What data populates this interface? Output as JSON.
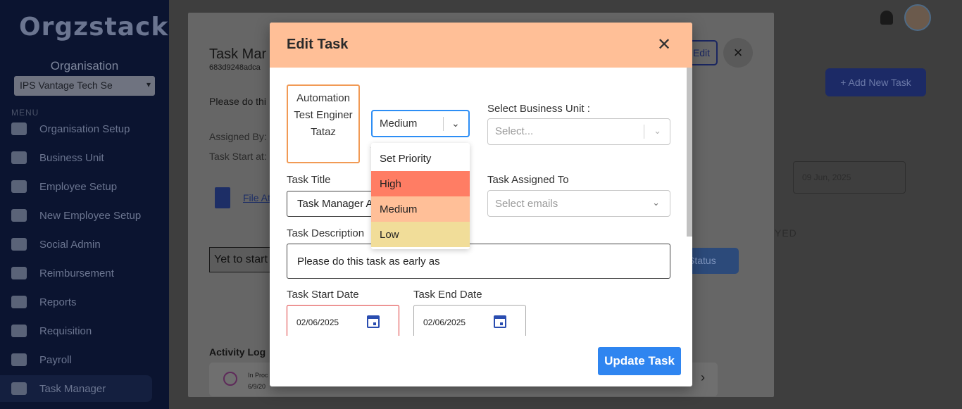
{
  "sidebar": {
    "logo": "Orgzstack",
    "org_label": "Organisation",
    "org_select": "IPS Vantage Tech Se",
    "menu_label": "MENU",
    "items": [
      {
        "label": "Organisation Setup"
      },
      {
        "label": "Business Unit"
      },
      {
        "label": "Employee Setup"
      },
      {
        "label": "New Employee Setup"
      },
      {
        "label": "Social Admin"
      },
      {
        "label": "Reimbursement"
      },
      {
        "label": "Reports"
      },
      {
        "label": "Requisition"
      },
      {
        "label": "Payroll"
      },
      {
        "label": "Task Manager"
      }
    ]
  },
  "background": {
    "add_task_label": "+ Add New Task",
    "date_value": "09 Jun, 2025",
    "status_fragment": "YED"
  },
  "task_panel": {
    "title": "Task Mar",
    "id": "683d9248adca",
    "description": "Please do thi",
    "assigned_by": "Assigned By:",
    "task_start": "Task Start at:",
    "file_link": "File At",
    "status_value": "Yet to start",
    "status_button": "Status",
    "edit_label": "Edit",
    "close_icon": "×",
    "activity_title": "Activity Log",
    "log_status": "In Proc",
    "log_date": "6/9/20",
    "log_arrow": "›"
  },
  "modal": {
    "title": "Edit Task",
    "close_icon": "✕",
    "assignee_text": "Automation Test Enginer Tataz",
    "priority": {
      "selected": "Medium",
      "options": [
        {
          "label": "Set Priority"
        },
        {
          "label": "High"
        },
        {
          "label": "Medium"
        },
        {
          "label": "Low"
        }
      ]
    },
    "business_unit": {
      "label": "Select Business Unit :",
      "placeholder": "Select..."
    },
    "task_title": {
      "label": "Task Title",
      "value": "Task Manager A"
    },
    "assigned_to": {
      "label": "Task Assigned To",
      "placeholder": "Select emails"
    },
    "description": {
      "label": "Task Description",
      "value": "Please do this task as early as"
    },
    "start_date": {
      "label": "Task Start Date",
      "value": "02/06/2025"
    },
    "end_date": {
      "label": "Task End Date",
      "value": "02/06/2025"
    },
    "update_button": "Update Task"
  },
  "colors": {
    "modal_header": "#ffbf97",
    "priority_high": "#ff7d64",
    "priority_medium": "#ffbf98",
    "priority_low": "#f1dd99",
    "primary_button": "#2f85f0",
    "focus_border": "#2d8ef5"
  }
}
